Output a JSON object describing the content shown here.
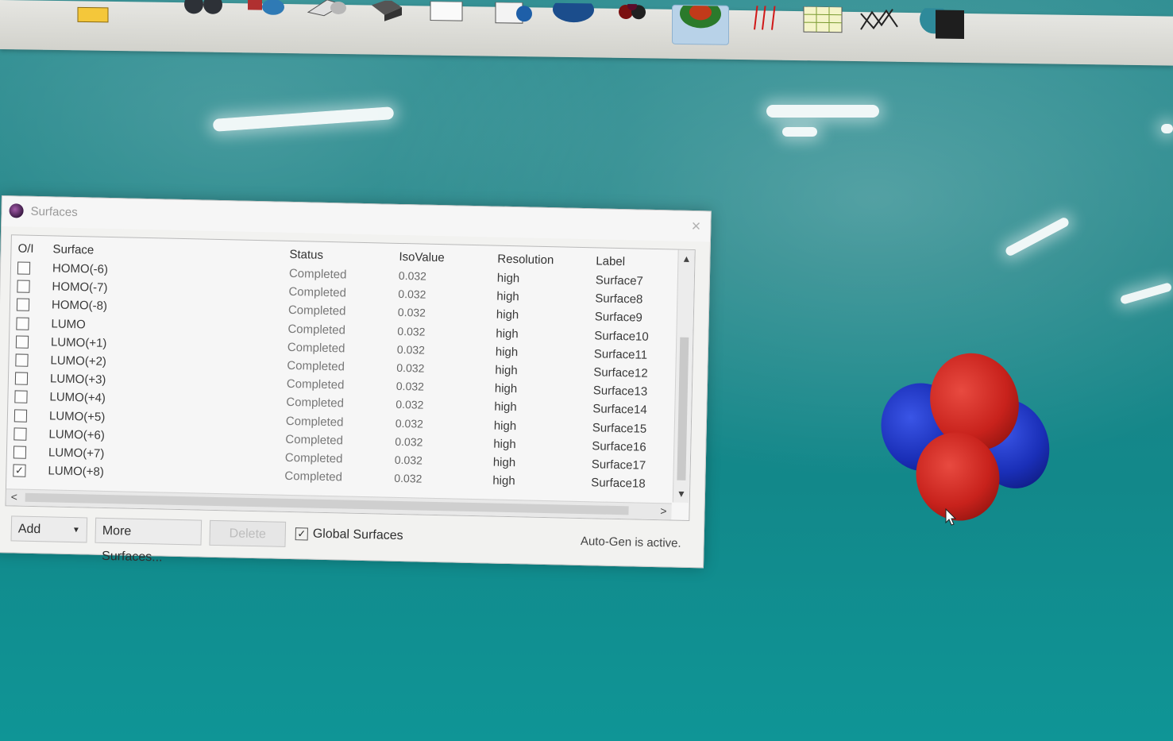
{
  "dialog": {
    "title": "Surfaces",
    "close_glyph": "×",
    "headers": {
      "onoff": "O/I",
      "surface": "Surface",
      "status": "Status",
      "isovalue": "IsoValue",
      "resolution": "Resolution",
      "label": "Label"
    },
    "rows": [
      {
        "checked": false,
        "surface": "HOMO(-6)",
        "status": "Completed",
        "isovalue": "0.032",
        "resolution": "high",
        "label": "Surface7"
      },
      {
        "checked": false,
        "surface": "HOMO(-7)",
        "status": "Completed",
        "isovalue": "0.032",
        "resolution": "high",
        "label": "Surface8"
      },
      {
        "checked": false,
        "surface": "HOMO(-8)",
        "status": "Completed",
        "isovalue": "0.032",
        "resolution": "high",
        "label": "Surface9"
      },
      {
        "checked": false,
        "surface": "LUMO",
        "status": "Completed",
        "isovalue": "0.032",
        "resolution": "high",
        "label": "Surface10"
      },
      {
        "checked": false,
        "surface": "LUMO(+1)",
        "status": "Completed",
        "isovalue": "0.032",
        "resolution": "high",
        "label": "Surface11"
      },
      {
        "checked": false,
        "surface": "LUMO(+2)",
        "status": "Completed",
        "isovalue": "0.032",
        "resolution": "high",
        "label": "Surface12"
      },
      {
        "checked": false,
        "surface": "LUMO(+3)",
        "status": "Completed",
        "isovalue": "0.032",
        "resolution": "high",
        "label": "Surface13"
      },
      {
        "checked": false,
        "surface": "LUMO(+4)",
        "status": "Completed",
        "isovalue": "0.032",
        "resolution": "high",
        "label": "Surface14"
      },
      {
        "checked": false,
        "surface": "LUMO(+5)",
        "status": "Completed",
        "isovalue": "0.032",
        "resolution": "high",
        "label": "Surface15"
      },
      {
        "checked": false,
        "surface": "LUMO(+6)",
        "status": "Completed",
        "isovalue": "0.032",
        "resolution": "high",
        "label": "Surface16"
      },
      {
        "checked": false,
        "surface": "LUMO(+7)",
        "status": "Completed",
        "isovalue": "0.032",
        "resolution": "high",
        "label": "Surface17"
      },
      {
        "checked": true,
        "surface": "LUMO(+8)",
        "status": "Completed",
        "isovalue": "0.032",
        "resolution": "high",
        "label": "Surface18"
      }
    ],
    "buttons": {
      "add": "Add",
      "add_caret": "▼",
      "more": "More Surfaces...",
      "delete": "Delete"
    },
    "global_surfaces": {
      "label": "Global Surfaces",
      "checked": true
    },
    "status_text": "Auto-Gen is active.",
    "scroll_glyphs": {
      "up": "▲",
      "down": "▼",
      "left": "<",
      "right": ">"
    }
  },
  "toolbar": {
    "icons": [
      "molecule-icon",
      "bond-icon",
      "surface-icon",
      "plane-icon",
      "solid-icon",
      "box-icon",
      "document-icon",
      "info-icon",
      "orbital-icon",
      "density-icon",
      "spectrum-icon",
      "spreadsheet-icon",
      "graph-icon",
      "globe-icon"
    ]
  },
  "colors": {
    "orbital_positive": "#c8221c",
    "orbital_negative": "#1a2fb8",
    "active_tool": "#b8d2e8",
    "background": "#1f8487"
  }
}
